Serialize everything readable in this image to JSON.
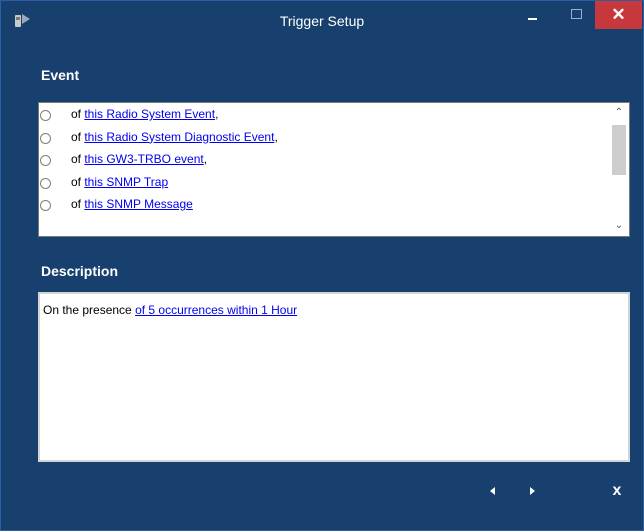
{
  "window": {
    "title": "Trigger Setup",
    "icons": {
      "app": "app-radio-icon",
      "minimize": "minimize-icon",
      "maximize": "maximize-icon",
      "close": "close-icon"
    },
    "close_glyph": "✕"
  },
  "event": {
    "label": "Event",
    "items": [
      {
        "prefix": "of ",
        "link": "this Radio System Event",
        "suffix": ","
      },
      {
        "prefix": "of ",
        "link": "this Radio System Diagnostic Event",
        "suffix": ","
      },
      {
        "prefix": "of ",
        "link": "this GW3-TRBO event",
        "suffix": ","
      },
      {
        "prefix": "of ",
        "link": "this SNMP Trap",
        "suffix": ""
      },
      {
        "prefix": "of ",
        "link": "this SNMP Message",
        "suffix": ""
      }
    ],
    "scroll_up_glyph": "⌃",
    "scroll_down_glyph": "⌄"
  },
  "description": {
    "label": "Description",
    "prefix": "On the presence ",
    "link": "of 5 occurrences within 1 Hour"
  },
  "footer": {
    "close_label": "x"
  },
  "colors": {
    "window_bg": "#17406e",
    "close_button": "#c7383c",
    "link": "#0000ee"
  }
}
